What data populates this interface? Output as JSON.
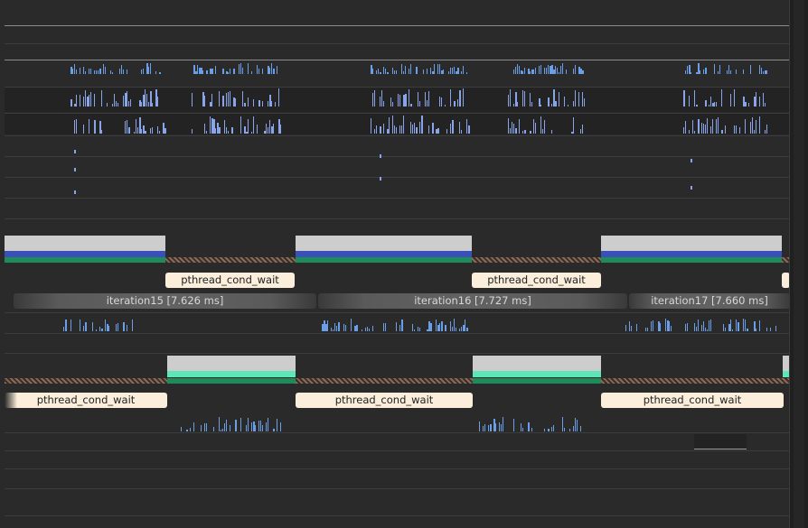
{
  "timeline": {
    "zone_labels": [
      {
        "text": "pthread_cond_wait"
      },
      {
        "text": "pthread_cond_wait"
      },
      {
        "text": "pthread_cond_wait"
      },
      {
        "text": "pthread_cond_wait"
      },
      {
        "text": "pthread_cond_wait"
      }
    ],
    "iterations": [
      {
        "text": "iteration15 [7.626 ms]"
      },
      {
        "text": "iteration16 [7.727 ms]"
      },
      {
        "text": "iteration17 [7.660 ms]"
      }
    ]
  },
  "colors": {
    "background": "#2a2a2a",
    "cpu_bars": "#6a9fe8",
    "thread_bars": "#8aa4e8",
    "label_bg": "#fbeedb",
    "active_gray": "#cdcdcd",
    "blue_strip": "#3b4fb8",
    "mint_strip": "#5fe6b7",
    "hatch": "#8a6a58"
  }
}
